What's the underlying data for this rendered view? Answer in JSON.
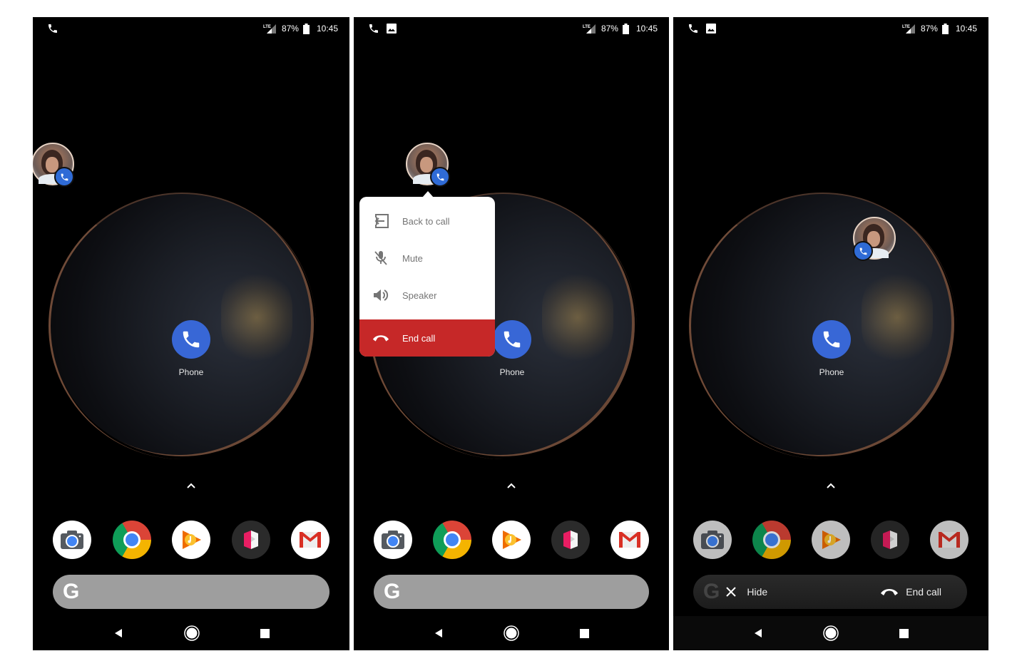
{
  "panels": [
    {
      "id": "before-tap",
      "status_bar": {
        "left_icons": [
          "phone-call-icon"
        ],
        "network": "LTE",
        "battery": "87%",
        "time": "10:45"
      },
      "home_app": {
        "label": "Phone"
      },
      "dock": [
        "Camera",
        "Chrome",
        "Play Music",
        "Kiosk",
        "Gmail"
      ],
      "search_bar": {
        "logo": "G"
      }
    },
    {
      "id": "bubble-menu-open",
      "status_bar": {
        "left_icons": [
          "phone-call-icon",
          "image-icon"
        ],
        "network": "LTE",
        "battery": "87%",
        "time": "10:45"
      },
      "home_app": {
        "label": "Phone"
      },
      "bubble_menu": {
        "items": [
          {
            "label": "Back to call",
            "icon": "back-to-call-icon"
          },
          {
            "label": "Mute",
            "icon": "mic-off-icon"
          },
          {
            "label": "Speaker",
            "icon": "speaker-icon"
          }
        ],
        "end_call": {
          "label": "End call",
          "icon": "end-call-icon",
          "color": "#c62828"
        }
      },
      "dock": [
        "Camera",
        "Chrome",
        "Play Music",
        "Kiosk",
        "Gmail"
      ],
      "search_bar": {
        "logo": "G"
      }
    },
    {
      "id": "bubble-dragging",
      "status_bar": {
        "left_icons": [
          "phone-call-icon",
          "image-icon"
        ],
        "network": "LTE",
        "battery": "87%",
        "time": "10:45"
      },
      "home_app": {
        "label": "Phone"
      },
      "dock": [
        "Camera",
        "Chrome",
        "Play Music",
        "Kiosk",
        "Gmail"
      ],
      "call_bar": {
        "hide_label": "Hide",
        "end_call_label": "End call",
        "logo": "G"
      }
    }
  ],
  "colors": {
    "phone_blue": "#3867d6",
    "badge_blue": "#2f6bd6",
    "end_call_red": "#c62828",
    "search_gray": "#9e9e9e"
  }
}
